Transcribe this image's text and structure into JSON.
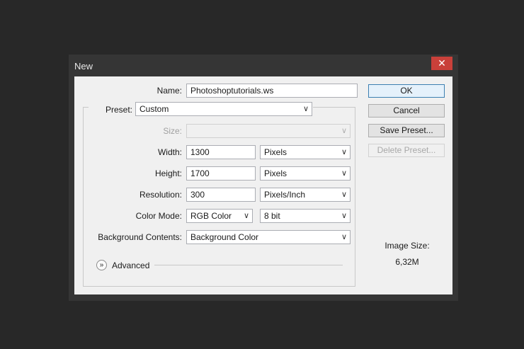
{
  "window": {
    "title": "New",
    "close_glyph": "✕"
  },
  "form": {
    "name": {
      "label": "Name:",
      "value": "Photoshoptutorials.ws"
    },
    "preset": {
      "label": "Preset:",
      "value": "Custom"
    },
    "size": {
      "label": "Size:",
      "value": ""
    },
    "width": {
      "label": "Width:",
      "value": "1300",
      "unit": "Pixels"
    },
    "height": {
      "label": "Height:",
      "value": "1700",
      "unit": "Pixels"
    },
    "resolution": {
      "label": "Resolution:",
      "value": "300",
      "unit": "Pixels/Inch"
    },
    "color_mode": {
      "label": "Color Mode:",
      "value": "RGB Color",
      "depth": "8 bit"
    },
    "background": {
      "label": "Background Contents:",
      "value": "Background Color"
    },
    "advanced": {
      "label": "Advanced",
      "icon": "»"
    }
  },
  "buttons": {
    "ok": "OK",
    "cancel": "Cancel",
    "save_preset": "Save Preset...",
    "delete_preset": "Delete Preset..."
  },
  "image_size": {
    "label": "Image Size:",
    "value": "6,32M"
  },
  "icons": {
    "chevron": "∨"
  }
}
